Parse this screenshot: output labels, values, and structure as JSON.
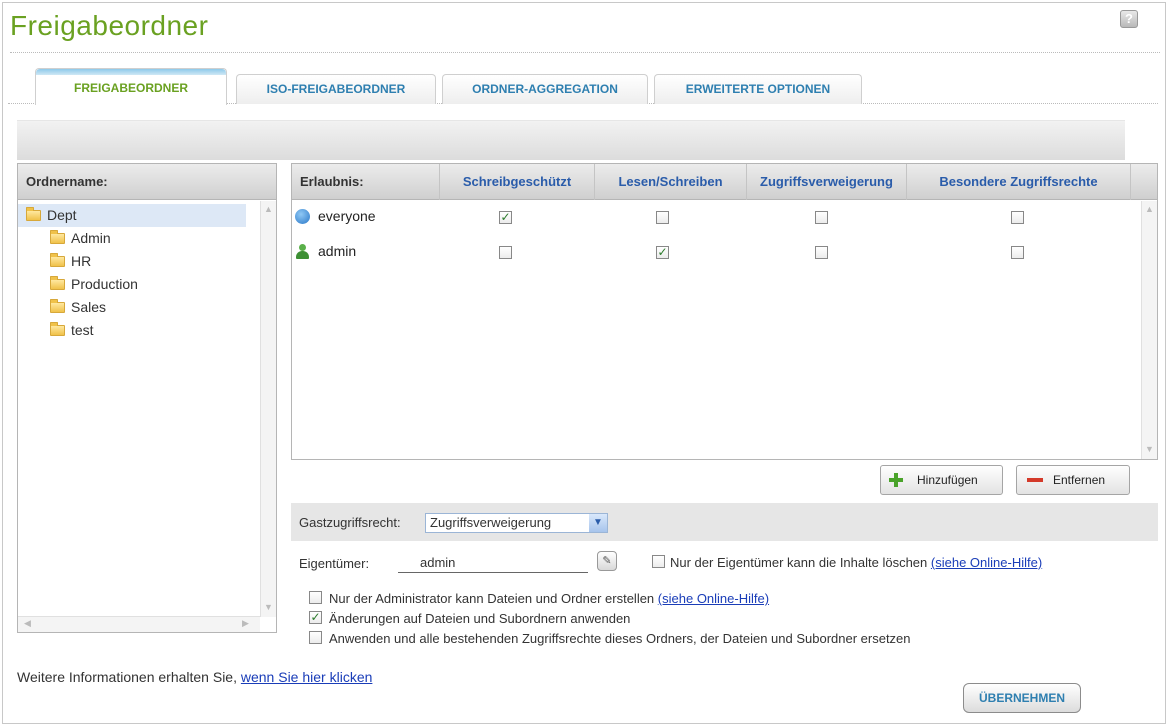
{
  "page": {
    "title": "Freigabeordner"
  },
  "tabs": [
    {
      "label": "FREIGABEORDNER",
      "active": true
    },
    {
      "label": "ISO-FREIGABEORDNER",
      "active": false
    },
    {
      "label": "ORDNER-AGGREGATION",
      "active": false
    },
    {
      "label": "ERWEITERTE OPTIONEN",
      "active": false
    }
  ],
  "folders": {
    "header": "Ordnername:",
    "items": [
      {
        "label": "Dept",
        "selected": true
      },
      {
        "label": "Admin"
      },
      {
        "label": "HR"
      },
      {
        "label": "Production"
      },
      {
        "label": "Sales"
      },
      {
        "label": "test"
      }
    ]
  },
  "permissions": {
    "columns": [
      "Erlaubnis:",
      "Schreibgeschützt",
      "Lesen/Schreiben",
      "Zugriffsverweigerung",
      "Besondere Zugriffsrechte"
    ],
    "rows": [
      {
        "name": "everyone",
        "icon": "group-icon",
        "checks": [
          true,
          false,
          false,
          false
        ]
      },
      {
        "name": "admin",
        "icon": "user-icon",
        "checks": [
          false,
          true,
          false,
          false
        ]
      }
    ],
    "add_label": "Hinzufügen",
    "remove_label": "Entfernen"
  },
  "guest": {
    "label": "Gastzugriffsrecht:",
    "value": "Zugriffsverweigerung"
  },
  "owner": {
    "label": "Eigentümer:",
    "value": "admin",
    "only_owner_delete_label": "Nur der Eigentümer kann die Inhalte löschen",
    "only_owner_delete_checked": false,
    "help_link": "(siehe Online-Hilfe)"
  },
  "options": [
    {
      "label": "Nur der Administrator kann Dateien und Ordner erstellen",
      "checked": false,
      "link": "(siehe Online-Hilfe)"
    },
    {
      "label": "Änderungen auf Dateien und Subordnern anwenden",
      "checked": true,
      "link": ""
    },
    {
      "label": "Anwenden und alle bestehenden Zugriffsrechte dieses Ordners, der Dateien und Subordner ersetzen",
      "checked": false,
      "link": ""
    }
  ],
  "footer": {
    "info_text": "Weitere Informationen erhalten Sie,",
    "info_link": "wenn Sie hier klicken",
    "apply_label": "ÜBERNEHMEN"
  },
  "colors": {
    "title_green": "#6aa121",
    "tab_blue": "#2e7fb0",
    "header_blue": "#2a5caa"
  }
}
